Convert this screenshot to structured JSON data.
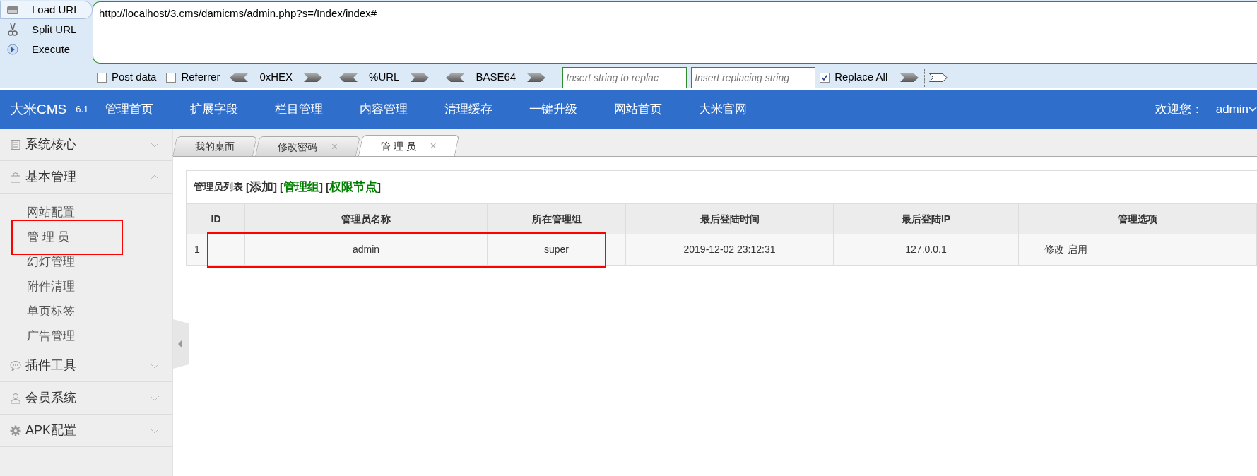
{
  "toolbar": {
    "buttons": [
      {
        "label": "Load URL",
        "selected": true
      },
      {
        "label": "Split URL",
        "selected": false
      },
      {
        "label": "Execute",
        "selected": false
      }
    ],
    "url": "http://localhost/3.cms/damicms/admin.php?s=/Index/index#",
    "options": [
      {
        "kind": "checkbox",
        "label": "Post data",
        "checked": false
      },
      {
        "kind": "checkbox",
        "label": "Referrer",
        "checked": false
      },
      {
        "kind": "encoder",
        "label": "0xHEX"
      },
      {
        "kind": "encoder",
        "label": "%URL"
      },
      {
        "kind": "encoder",
        "label": "BASE64"
      },
      {
        "kind": "field",
        "placeholder": "Insert string to replac"
      },
      {
        "kind": "field",
        "placeholder": "Insert replacing string"
      },
      {
        "kind": "checkbox",
        "label": "Replace All",
        "checked": true
      },
      {
        "kind": "arrow"
      },
      {
        "kind": "separator"
      },
      {
        "kind": "arrow_light"
      }
    ]
  },
  "navbar": {
    "brand": "大米CMS",
    "version": "6.1",
    "items": [
      "管理首页",
      "扩展字段",
      "栏目管理",
      "内容管理",
      "清理缓存",
      "一键升级",
      "网站首页",
      "大米官网"
    ],
    "welcome": "欢迎您：",
    "user": "admin"
  },
  "sidebar": {
    "groups": [
      {
        "label": "系统核心",
        "expanded": false
      },
      {
        "label": "基本管理",
        "expanded": true,
        "children": [
          {
            "label": "网站配置",
            "annotated": false
          },
          {
            "label": "管 理 员",
            "annotated": true
          },
          {
            "label": "幻灯管理",
            "annotated": false
          },
          {
            "label": "附件清理",
            "annotated": false
          },
          {
            "label": "单页标签",
            "annotated": false
          },
          {
            "label": "广告管理",
            "annotated": false
          }
        ]
      },
      {
        "label": "插件工具",
        "expanded": false
      },
      {
        "label": "会员系统",
        "expanded": false
      },
      {
        "label": "APK配置",
        "expanded": false
      }
    ]
  },
  "tabs": [
    {
      "label": "我的桌面",
      "selected": false
    },
    {
      "label": "修改密码",
      "close": "×",
      "selected": false
    },
    {
      "label": "管 理 员",
      "close": "×",
      "selected": true
    }
  ],
  "panel": {
    "title": "管理员列表",
    "bracket_open": "[",
    "bracket_close": "]",
    "links": [
      {
        "label": "添加",
        "color": "#333333"
      },
      {
        "label": "管理组",
        "color": "#008000"
      },
      {
        "label": "权限节点",
        "color": "#008000"
      }
    ],
    "table": {
      "columns": [
        "ID",
        "管理员名称",
        "所在管理组",
        "最后登陆时间",
        "最后登陆IP",
        "管理选项"
      ],
      "rows": [
        {
          "annotated": true,
          "cells": [
            "1",
            "admin",
            "super",
            "2019-12-02 23:12:31",
            "127.0.0.1"
          ],
          "actions": [
            "修改",
            "启用"
          ]
        }
      ]
    }
  }
}
